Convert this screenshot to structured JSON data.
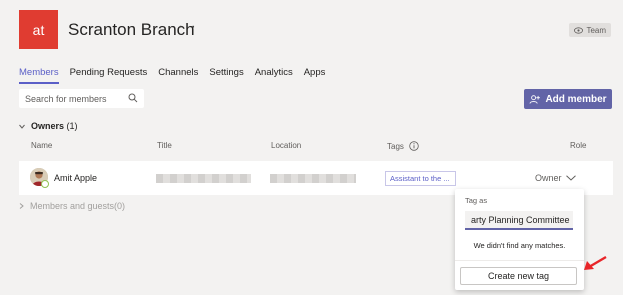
{
  "team": {
    "avatar_text": "at",
    "name": "Scranton Branch",
    "more": "···",
    "badge": "Team",
    "avatar_color": "#e03c31"
  },
  "tabs": [
    {
      "label": "Members",
      "active": true
    },
    {
      "label": "Pending Requests"
    },
    {
      "label": "Channels"
    },
    {
      "label": "Settings"
    },
    {
      "label": "Analytics"
    },
    {
      "label": "Apps"
    }
  ],
  "search": {
    "placeholder": "Search for members"
  },
  "add_member": {
    "label": "Add member"
  },
  "owners": {
    "title": "Owners",
    "count": "(1)"
  },
  "columns": {
    "name": "Name",
    "title": "Title",
    "location": "Location",
    "tags": "Tags",
    "role": "Role"
  },
  "member": {
    "name": "Amit Apple",
    "tag": "Assistant to the ...",
    "role": "Owner"
  },
  "guests": {
    "title": "Members and guests",
    "count": "(0)"
  },
  "tag_popup": {
    "label": "Tag as",
    "input_value": "arty Planning Committee",
    "no_match": "We didn't find any matches.",
    "create_label": "Create new tag"
  },
  "colors": {
    "accent": "#6264a7",
    "arrow": "#e8262a"
  }
}
